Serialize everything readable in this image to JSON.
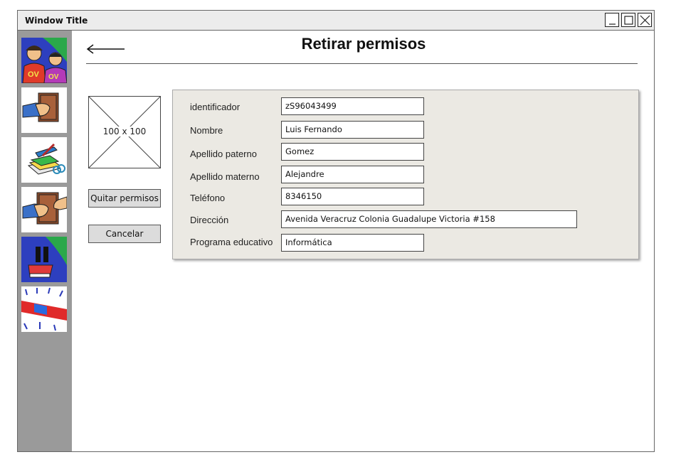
{
  "window": {
    "title": "Window Title"
  },
  "page": {
    "title": "Retirar permisos"
  },
  "image_placeholder": {
    "label": "100 x 100"
  },
  "buttons": {
    "remove_permissions": "Quitar permisos",
    "cancel": "Cancelar"
  },
  "form": {
    "fields": [
      {
        "label": "identificador",
        "value": "zS96043499"
      },
      {
        "label": "Nombre",
        "value": "Luis Fernando"
      },
      {
        "label": "Apellido paterno",
        "value": "Gomez"
      },
      {
        "label": "Apellido materno",
        "value": "Alejandre"
      },
      {
        "label": "Teléfono",
        "value": "8346150"
      },
      {
        "label": "Dirección",
        "value": "Avenida Veracruz Colonia Guadalupe Victoria #158"
      },
      {
        "label": "Programa educativo",
        "value": "Informática"
      }
    ]
  },
  "sidebar": {
    "items": [
      {
        "icon": "users-icon"
      },
      {
        "icon": "book-hand-icon"
      },
      {
        "icon": "documents-icon"
      },
      {
        "icon": "book-exchange-icon"
      },
      {
        "icon": "pause-book-icon"
      },
      {
        "icon": "alert-siren-icon"
      }
    ]
  }
}
